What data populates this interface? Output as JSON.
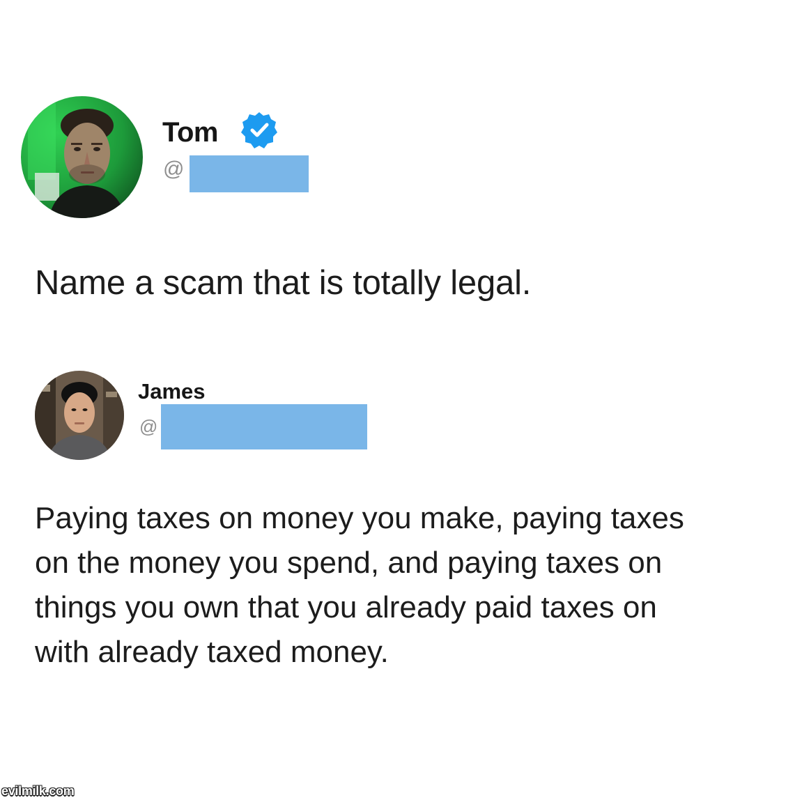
{
  "tweet_original": {
    "author_name": "Tom",
    "verified": true,
    "handle_prefix": "@",
    "handle_redacted": true,
    "text": "Name a scam that is totally legal.",
    "avatar_icon": "profile-photo-man-green-background"
  },
  "tweet_reply": {
    "author_name": "James",
    "handle_prefix": "@",
    "handle_redacted": true,
    "lines": [
      "Paying taxes on money you make, paying taxes",
      "on the money you spend, and paying taxes on",
      "things you own that you already paid taxes on",
      "with already taxed money."
    ],
    "avatar_icon": "profile-photo-man-gray-shirt"
  },
  "watermark": "evilmilk.com",
  "colors": {
    "redaction": "#7ab6e8",
    "verified_badge": "#1d9bf0",
    "text": "#1c1c1c",
    "muted": "#8e8e8e"
  }
}
